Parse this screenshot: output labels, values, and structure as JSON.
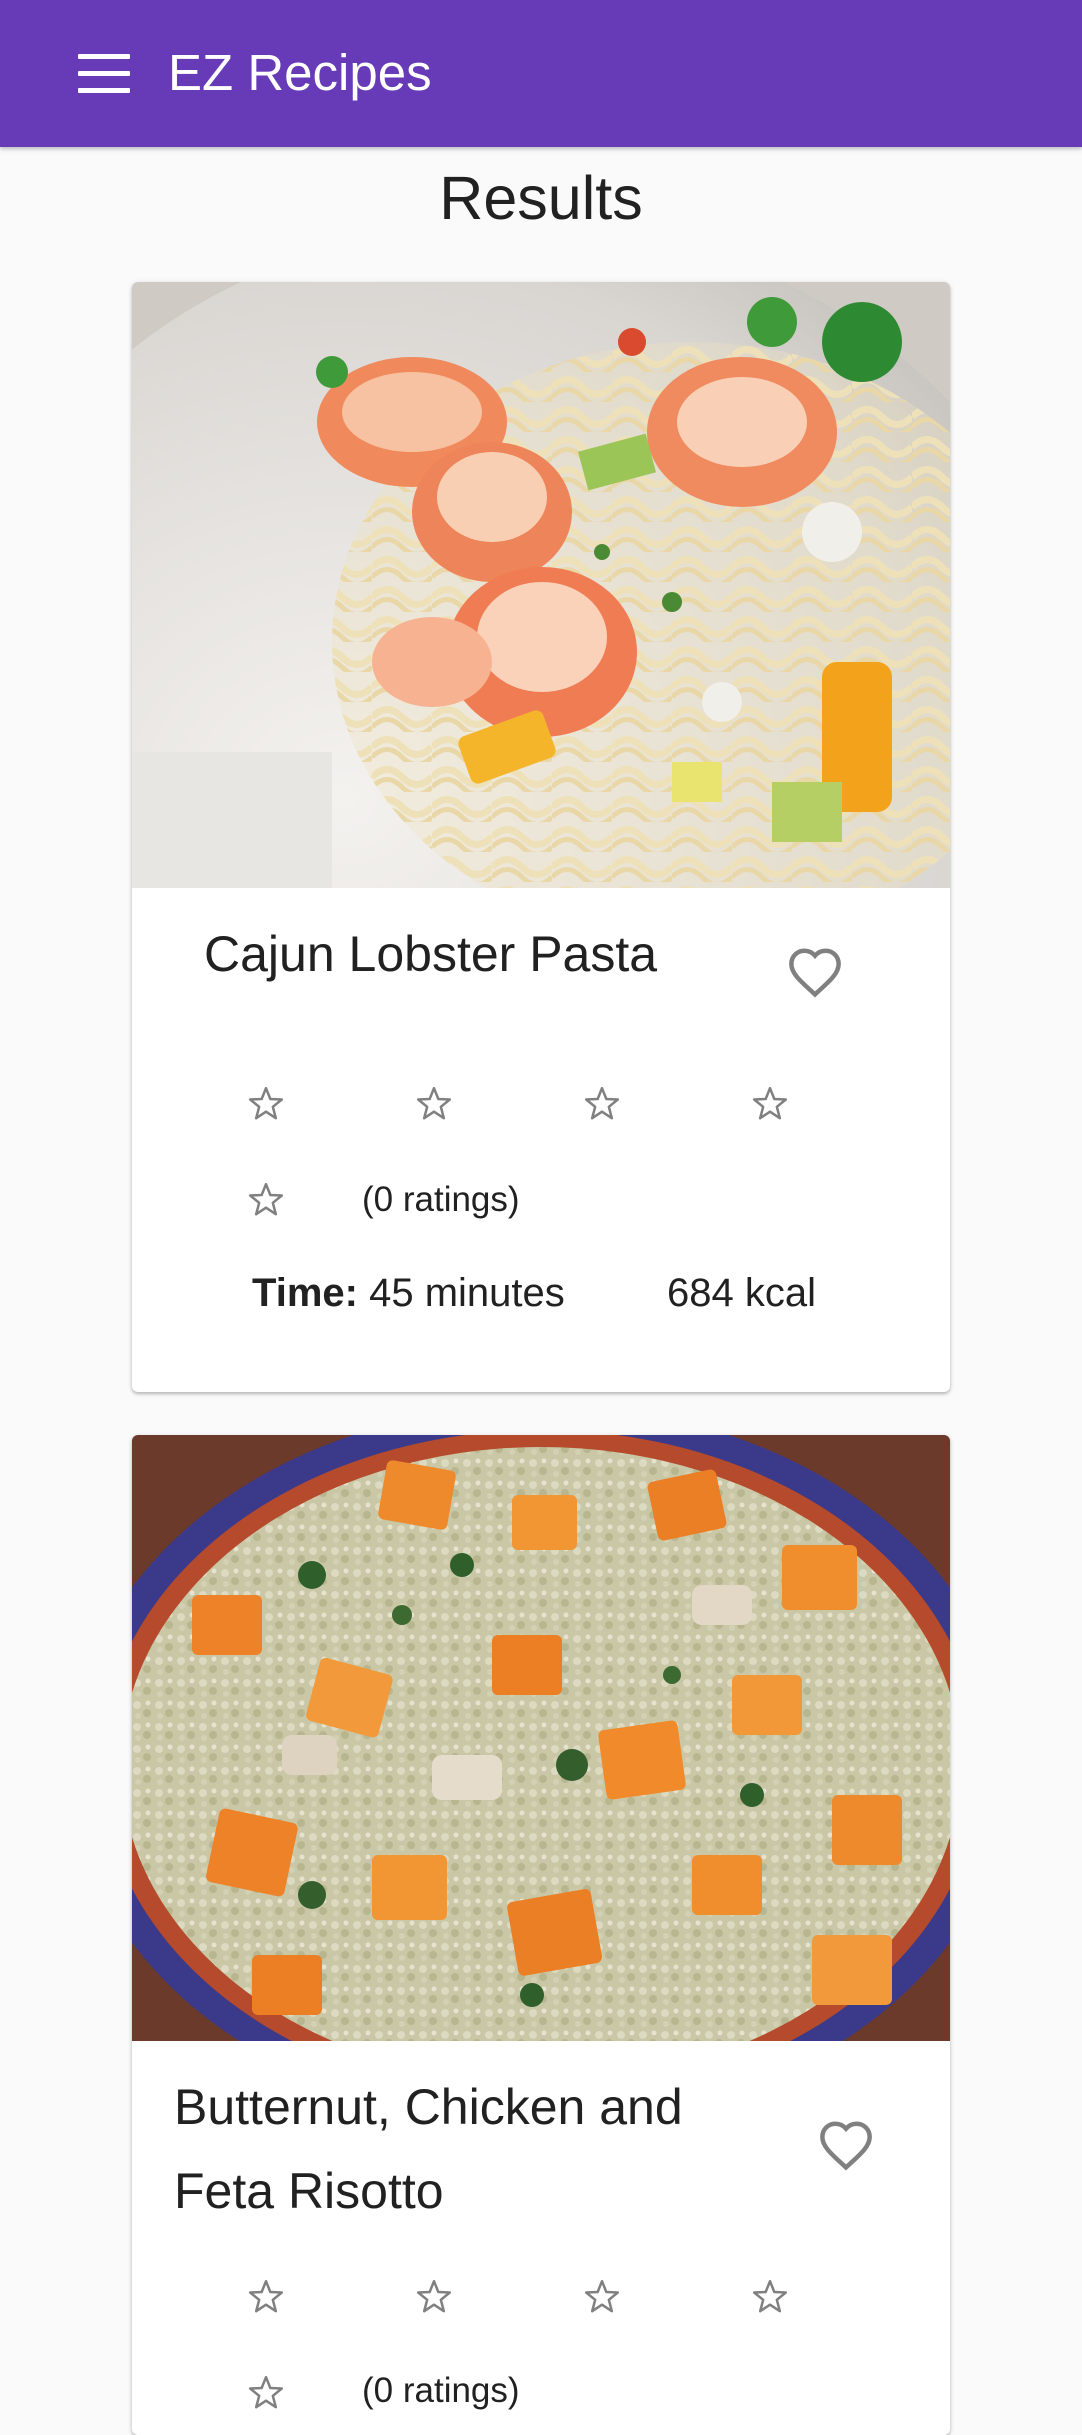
{
  "app": {
    "title": "EZ Recipes",
    "menu_icon": "hamburger-menu-icon"
  },
  "page": {
    "title": "Results"
  },
  "colors": {
    "app_bar": "#673ab7",
    "background": "#fafafa",
    "card": "#ffffff",
    "icon_gray": "#808080"
  },
  "recipes": [
    {
      "name": "Cajun Lobster Pasta",
      "favorite_icon": "heart-outline-icon",
      "rating_stars": 5,
      "rating": 0,
      "ratings_text": "(0 ratings)",
      "time_label": "Time:",
      "time_value": "45 minutes",
      "calories": "684 kcal"
    },
    {
      "name_line1": "Butternut, Chicken and",
      "name_line2": "Feta Risotto",
      "favorite_icon": "heart-outline-icon",
      "rating_stars": 5,
      "rating": 0,
      "ratings_text": "(0 ratings)"
    }
  ]
}
